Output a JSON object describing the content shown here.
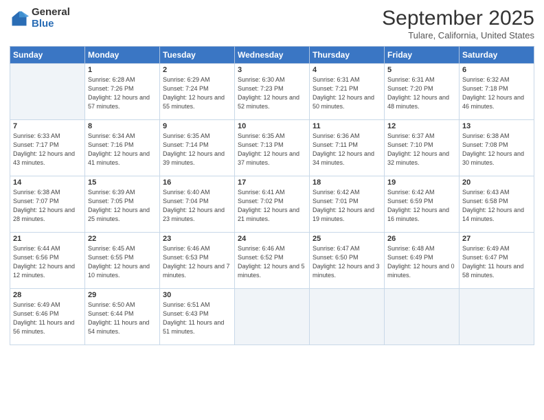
{
  "header": {
    "logo_general": "General",
    "logo_blue": "Blue",
    "month": "September 2025",
    "location": "Tulare, California, United States"
  },
  "days_of_week": [
    "Sunday",
    "Monday",
    "Tuesday",
    "Wednesday",
    "Thursday",
    "Friday",
    "Saturday"
  ],
  "weeks": [
    [
      {
        "day": "",
        "sunrise": "",
        "sunset": "",
        "daylight": ""
      },
      {
        "day": "1",
        "sunrise": "Sunrise: 6:28 AM",
        "sunset": "Sunset: 7:26 PM",
        "daylight": "Daylight: 12 hours and 57 minutes."
      },
      {
        "day": "2",
        "sunrise": "Sunrise: 6:29 AM",
        "sunset": "Sunset: 7:24 PM",
        "daylight": "Daylight: 12 hours and 55 minutes."
      },
      {
        "day": "3",
        "sunrise": "Sunrise: 6:30 AM",
        "sunset": "Sunset: 7:23 PM",
        "daylight": "Daylight: 12 hours and 52 minutes."
      },
      {
        "day": "4",
        "sunrise": "Sunrise: 6:31 AM",
        "sunset": "Sunset: 7:21 PM",
        "daylight": "Daylight: 12 hours and 50 minutes."
      },
      {
        "day": "5",
        "sunrise": "Sunrise: 6:31 AM",
        "sunset": "Sunset: 7:20 PM",
        "daylight": "Daylight: 12 hours and 48 minutes."
      },
      {
        "day": "6",
        "sunrise": "Sunrise: 6:32 AM",
        "sunset": "Sunset: 7:18 PM",
        "daylight": "Daylight: 12 hours and 46 minutes."
      }
    ],
    [
      {
        "day": "7",
        "sunrise": "Sunrise: 6:33 AM",
        "sunset": "Sunset: 7:17 PM",
        "daylight": "Daylight: 12 hours and 43 minutes."
      },
      {
        "day": "8",
        "sunrise": "Sunrise: 6:34 AM",
        "sunset": "Sunset: 7:16 PM",
        "daylight": "Daylight: 12 hours and 41 minutes."
      },
      {
        "day": "9",
        "sunrise": "Sunrise: 6:35 AM",
        "sunset": "Sunset: 7:14 PM",
        "daylight": "Daylight: 12 hours and 39 minutes."
      },
      {
        "day": "10",
        "sunrise": "Sunrise: 6:35 AM",
        "sunset": "Sunset: 7:13 PM",
        "daylight": "Daylight: 12 hours and 37 minutes."
      },
      {
        "day": "11",
        "sunrise": "Sunrise: 6:36 AM",
        "sunset": "Sunset: 7:11 PM",
        "daylight": "Daylight: 12 hours and 34 minutes."
      },
      {
        "day": "12",
        "sunrise": "Sunrise: 6:37 AM",
        "sunset": "Sunset: 7:10 PM",
        "daylight": "Daylight: 12 hours and 32 minutes."
      },
      {
        "day": "13",
        "sunrise": "Sunrise: 6:38 AM",
        "sunset": "Sunset: 7:08 PM",
        "daylight": "Daylight: 12 hours and 30 minutes."
      }
    ],
    [
      {
        "day": "14",
        "sunrise": "Sunrise: 6:38 AM",
        "sunset": "Sunset: 7:07 PM",
        "daylight": "Daylight: 12 hours and 28 minutes."
      },
      {
        "day": "15",
        "sunrise": "Sunrise: 6:39 AM",
        "sunset": "Sunset: 7:05 PM",
        "daylight": "Daylight: 12 hours and 25 minutes."
      },
      {
        "day": "16",
        "sunrise": "Sunrise: 6:40 AM",
        "sunset": "Sunset: 7:04 PM",
        "daylight": "Daylight: 12 hours and 23 minutes."
      },
      {
        "day": "17",
        "sunrise": "Sunrise: 6:41 AM",
        "sunset": "Sunset: 7:02 PM",
        "daylight": "Daylight: 12 hours and 21 minutes."
      },
      {
        "day": "18",
        "sunrise": "Sunrise: 6:42 AM",
        "sunset": "Sunset: 7:01 PM",
        "daylight": "Daylight: 12 hours and 19 minutes."
      },
      {
        "day": "19",
        "sunrise": "Sunrise: 6:42 AM",
        "sunset": "Sunset: 6:59 PM",
        "daylight": "Daylight: 12 hours and 16 minutes."
      },
      {
        "day": "20",
        "sunrise": "Sunrise: 6:43 AM",
        "sunset": "Sunset: 6:58 PM",
        "daylight": "Daylight: 12 hours and 14 minutes."
      }
    ],
    [
      {
        "day": "21",
        "sunrise": "Sunrise: 6:44 AM",
        "sunset": "Sunset: 6:56 PM",
        "daylight": "Daylight: 12 hours and 12 minutes."
      },
      {
        "day": "22",
        "sunrise": "Sunrise: 6:45 AM",
        "sunset": "Sunset: 6:55 PM",
        "daylight": "Daylight: 12 hours and 10 minutes."
      },
      {
        "day": "23",
        "sunrise": "Sunrise: 6:46 AM",
        "sunset": "Sunset: 6:53 PM",
        "daylight": "Daylight: 12 hours and 7 minutes."
      },
      {
        "day": "24",
        "sunrise": "Sunrise: 6:46 AM",
        "sunset": "Sunset: 6:52 PM",
        "daylight": "Daylight: 12 hours and 5 minutes."
      },
      {
        "day": "25",
        "sunrise": "Sunrise: 6:47 AM",
        "sunset": "Sunset: 6:50 PM",
        "daylight": "Daylight: 12 hours and 3 minutes."
      },
      {
        "day": "26",
        "sunrise": "Sunrise: 6:48 AM",
        "sunset": "Sunset: 6:49 PM",
        "daylight": "Daylight: 12 hours and 0 minutes."
      },
      {
        "day": "27",
        "sunrise": "Sunrise: 6:49 AM",
        "sunset": "Sunset: 6:47 PM",
        "daylight": "Daylight: 11 hours and 58 minutes."
      }
    ],
    [
      {
        "day": "28",
        "sunrise": "Sunrise: 6:49 AM",
        "sunset": "Sunset: 6:46 PM",
        "daylight": "Daylight: 11 hours and 56 minutes."
      },
      {
        "day": "29",
        "sunrise": "Sunrise: 6:50 AM",
        "sunset": "Sunset: 6:44 PM",
        "daylight": "Daylight: 11 hours and 54 minutes."
      },
      {
        "day": "30",
        "sunrise": "Sunrise: 6:51 AM",
        "sunset": "Sunset: 6:43 PM",
        "daylight": "Daylight: 11 hours and 51 minutes."
      },
      {
        "day": "",
        "sunrise": "",
        "sunset": "",
        "daylight": ""
      },
      {
        "day": "",
        "sunrise": "",
        "sunset": "",
        "daylight": ""
      },
      {
        "day": "",
        "sunrise": "",
        "sunset": "",
        "daylight": ""
      },
      {
        "day": "",
        "sunrise": "",
        "sunset": "",
        "daylight": ""
      }
    ]
  ]
}
